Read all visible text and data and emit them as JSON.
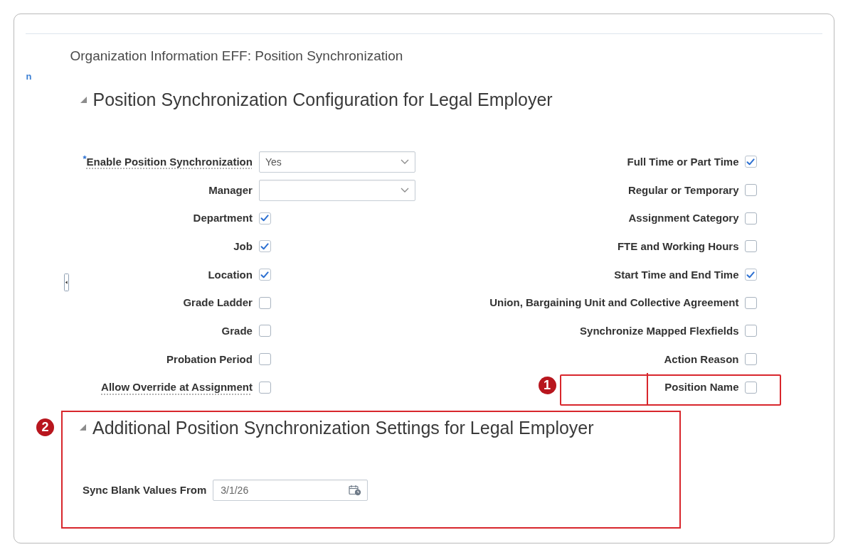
{
  "side_link": "n",
  "page_title": "Organization Information EFF: Position Synchronization",
  "sections": [
    {
      "title": "Position Synchronization Configuration for Legal Employer",
      "expanded": true,
      "left_fields": [
        {
          "kind": "select",
          "label": "Enable Position Synchronization",
          "required_mark": "*",
          "help": true,
          "value": "Yes"
        },
        {
          "kind": "select",
          "label": "Manager",
          "help": false
        },
        {
          "kind": "checkbox",
          "label": "Department",
          "help": false,
          "checked": true
        },
        {
          "kind": "checkbox",
          "label": "Job",
          "help": false,
          "checked": true
        },
        {
          "kind": "checkbox",
          "label": "Location",
          "help": false,
          "checked": true
        },
        {
          "kind": "checkbox",
          "label": "Grade Ladder",
          "help": false,
          "checked": false
        },
        {
          "kind": "checkbox",
          "label": "Grade",
          "help": false,
          "checked": false
        },
        {
          "kind": "checkbox",
          "label": "Probation Period",
          "help": false,
          "checked": false
        },
        {
          "kind": "checkbox",
          "label": "Allow Override at Assignment",
          "help": true,
          "checked": false
        }
      ],
      "right_fields": [
        {
          "kind": "checkbox",
          "label": "Full Time or Part Time",
          "help": false,
          "checked": true
        },
        {
          "kind": "checkbox",
          "label": "Regular or Temporary",
          "help": false,
          "checked": false
        },
        {
          "kind": "checkbox",
          "label": "Assignment Category",
          "help": false,
          "checked": false
        },
        {
          "kind": "checkbox",
          "label": "FTE and Working Hours",
          "help": false,
          "checked": false
        },
        {
          "kind": "checkbox",
          "label": "Start Time and End Time",
          "help": false,
          "checked": true
        },
        {
          "kind": "checkbox",
          "label": "Union, Bargaining Unit and Collective Agreement",
          "help": false,
          "checked": false
        },
        {
          "kind": "checkbox",
          "label": "Synchronize Mapped Flexfields",
          "help": false,
          "checked": false
        },
        {
          "kind": "checkbox",
          "label": "Action Reason",
          "help": false,
          "checked": false
        },
        {
          "kind": "checkbox",
          "label": "Position Name",
          "help": false,
          "checked": false,
          "callout": "1"
        }
      ]
    },
    {
      "title": "Additional Position Synchronization Settings for Legal Employer",
      "expanded": true,
      "callout": "2",
      "left_fields": [
        {
          "kind": "date",
          "label": "Sync Blank Values From",
          "help": false,
          "value": "3/1/26"
        }
      ]
    }
  ]
}
